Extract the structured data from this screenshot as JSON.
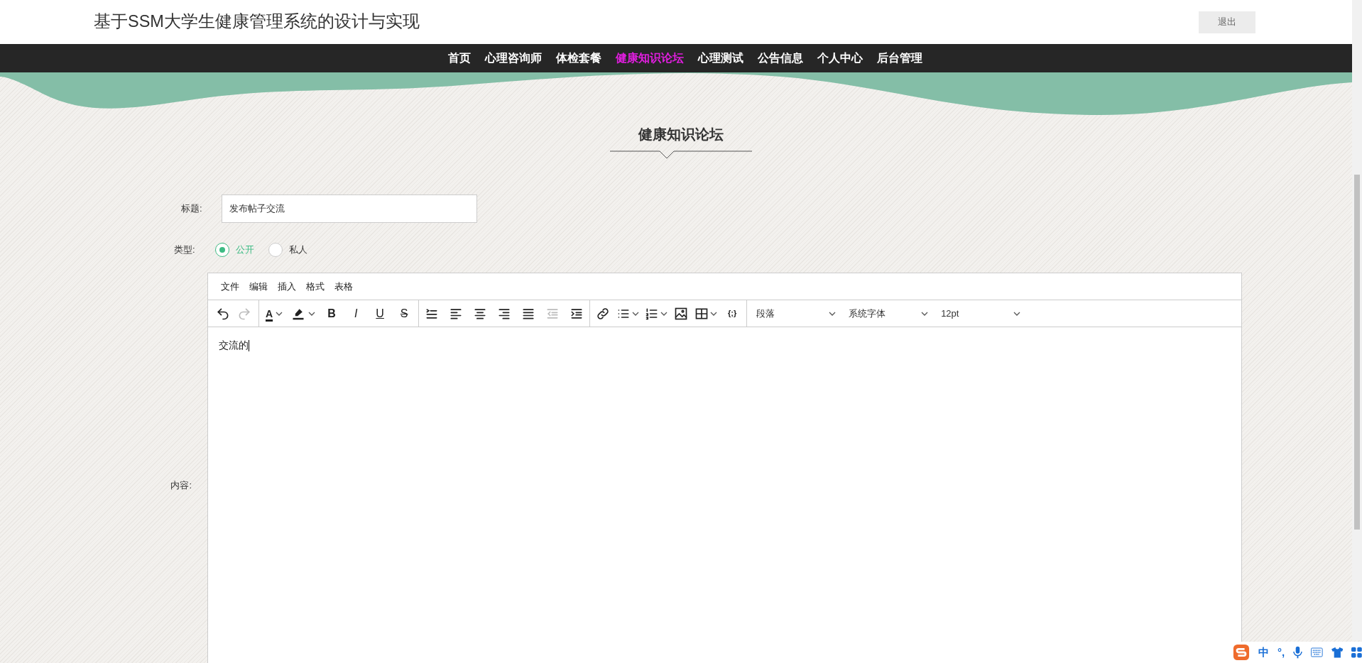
{
  "header": {
    "title": "基于SSM大学生健康管理系统的设计与实现",
    "logout": "退出"
  },
  "nav": [
    {
      "label": "首页",
      "selected": false
    },
    {
      "label": "心理咨询师",
      "selected": false
    },
    {
      "label": "体检套餐",
      "selected": false
    },
    {
      "label": "健康知识论坛",
      "selected": true
    },
    {
      "label": "心理测试",
      "selected": false
    },
    {
      "label": "公告信息",
      "selected": false
    },
    {
      "label": "个人中心",
      "selected": false
    },
    {
      "label": "后台管理",
      "selected": false
    }
  ],
  "heading": "健康知识论坛",
  "form": {
    "title_label": "标题:",
    "title_value": "发布帖子交流",
    "type_label": "类型:",
    "type_options": [
      {
        "label": "公开",
        "selected": true
      },
      {
        "label": "私人",
        "selected": false
      }
    ],
    "content_label": "内容:"
  },
  "editor": {
    "menu": [
      "文件",
      "编辑",
      "插入",
      "格式",
      "表格"
    ],
    "text_color_glyph": "A",
    "format_glyphs": [
      "B",
      "I",
      "U",
      "S"
    ],
    "code_glyph": "{;}",
    "redo_disabled": true,
    "outdent_disabled": true,
    "dropdowns": [
      "段落",
      "系统字体",
      "12pt"
    ],
    "content": "交流的"
  },
  "ime": {
    "language": "中",
    "punctuation": "°,"
  }
}
